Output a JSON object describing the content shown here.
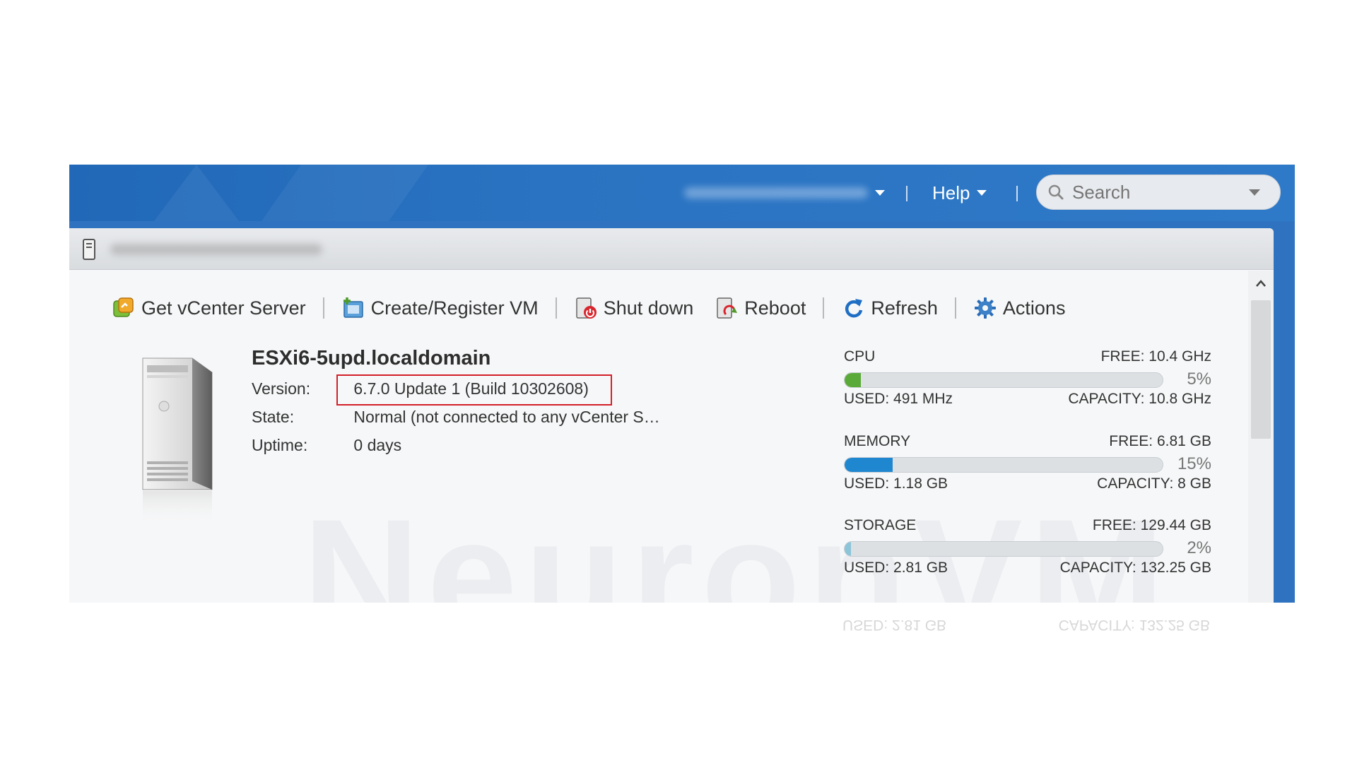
{
  "topbar": {
    "help_label": "Help",
    "search_placeholder": "Search"
  },
  "toolbar": {
    "get_vcenter": "Get vCenter Server",
    "create_vm": "Create/Register VM",
    "shutdown": "Shut down",
    "reboot": "Reboot",
    "refresh": "Refresh",
    "actions": "Actions"
  },
  "host": {
    "name": "ESXi6-5upd.localdomain",
    "version_label": "Version:",
    "version": "6.7.0 Update 1 (Build 10302608)",
    "state_label": "State:",
    "state": "Normal (not connected to any vCenter S…",
    "uptime_label": "Uptime:",
    "uptime": "0 days"
  },
  "resources": {
    "cpu": {
      "label": "CPU",
      "free": "FREE: 10.4 GHz",
      "percent": "5%",
      "used": "USED: 491 MHz",
      "capacity": "CAPACITY: 10.8 GHz",
      "fraction": 0.05,
      "color": "#5aaa3a"
    },
    "memory": {
      "label": "MEMORY",
      "free": "FREE: 6.81 GB",
      "percent": "15%",
      "used": "USED: 1.18 GB",
      "capacity": "CAPACITY: 8 GB",
      "fraction": 0.15,
      "color": "#1f86d0"
    },
    "storage": {
      "label": "STORAGE",
      "free": "FREE: 129.44 GB",
      "percent": "2%",
      "used": "USED: 2.81 GB",
      "capacity": "CAPACITY: 132.25 GB",
      "fraction": 0.02,
      "color": "#8cc4d8"
    }
  },
  "watermark": "NeuronVM"
}
